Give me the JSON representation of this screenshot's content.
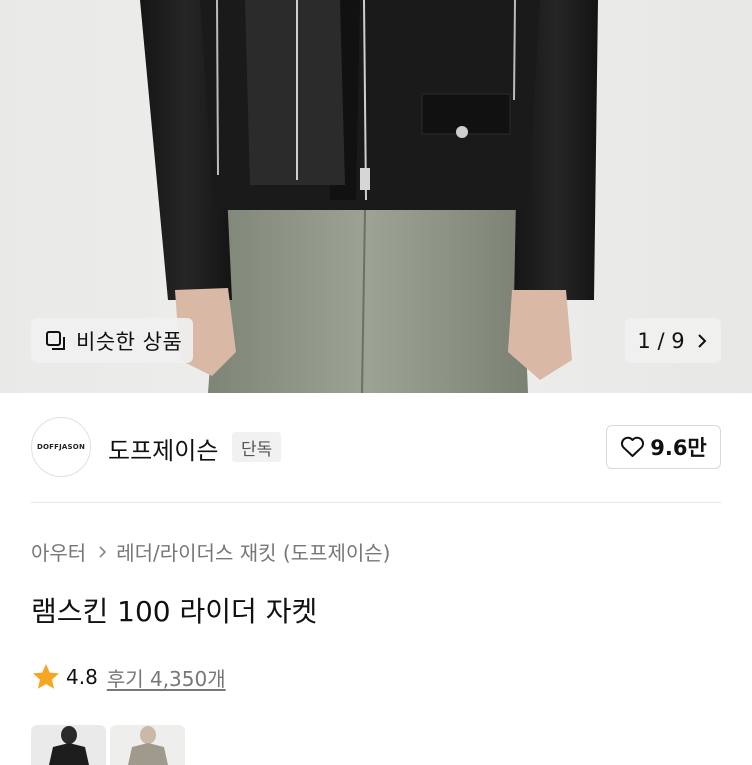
{
  "hero": {
    "similar_label": "비슷한 상품",
    "similar_icon": "similar-items-icon",
    "pager_text": "1 / 9",
    "pager_icon": "chevron-right-icon"
  },
  "brand": {
    "logo_text": "DOFFJASON",
    "name": "도프제이슨",
    "badge": "단독",
    "likes": "9.6만",
    "like_icon": "heart-outline-icon"
  },
  "breadcrumb": {
    "items": [
      "아우터",
      "레더/라이더스 재킷 (도프제이슨)"
    ],
    "separator_icon": "chevron-right-icon"
  },
  "product": {
    "title": "램스킨 100 라이더 자켓",
    "rating": "4.8",
    "rating_icon": "star-icon",
    "reviews": "후기 4,350개"
  },
  "colors": {
    "star": "#F5A623",
    "text_primary": "#111111",
    "text_secondary": "#777777"
  }
}
